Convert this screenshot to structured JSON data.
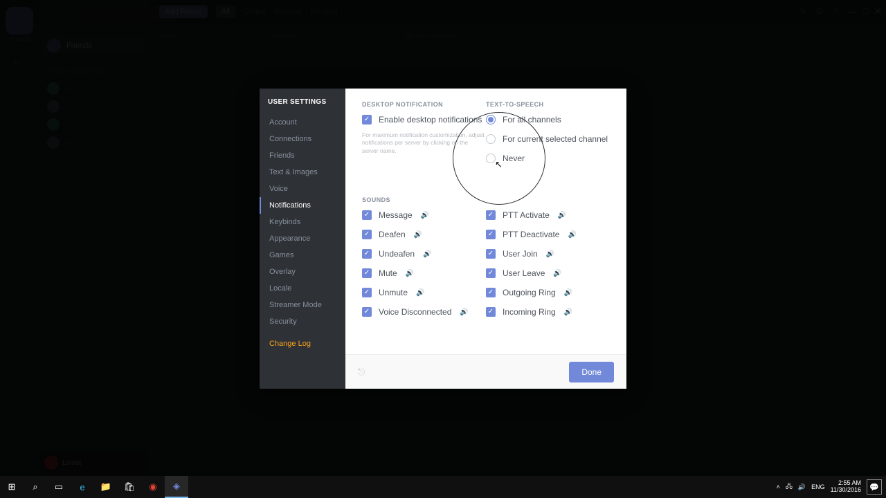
{
  "window": {
    "minimize": "—",
    "maximize": "□",
    "close": "✕"
  },
  "bg": {
    "friends_label": "FRIENDS",
    "add": "+",
    "friends_row": "Friends",
    "dm_header": "DIRECT MESSAGES",
    "tabs": {
      "add": "Add Friend",
      "all": "All",
      "online": "Online",
      "pending": "Pending",
      "blocked": "Blocked"
    },
    "cols": {
      "name": "NAME",
      "status": "STATUS",
      "mutual": "MUTUAL SERVERS"
    },
    "user": {
      "name": "Linnet"
    }
  },
  "modal": {
    "title": "USER SETTINGS",
    "nav": [
      {
        "k": "account",
        "label": "Account"
      },
      {
        "k": "connections",
        "label": "Connections"
      },
      {
        "k": "friends",
        "label": "Friends"
      },
      {
        "k": "text",
        "label": "Text & Images"
      },
      {
        "k": "voice",
        "label": "Voice"
      },
      {
        "k": "notifications",
        "label": "Notifications"
      },
      {
        "k": "keybinds",
        "label": "Keybinds"
      },
      {
        "k": "appearance",
        "label": "Appearance"
      },
      {
        "k": "games",
        "label": "Games"
      },
      {
        "k": "overlay",
        "label": "Overlay"
      },
      {
        "k": "locale",
        "label": "Locale"
      },
      {
        "k": "streamer",
        "label": "Streamer Mode"
      },
      {
        "k": "security",
        "label": "Security"
      },
      {
        "k": "changelog",
        "label": "Change Log"
      }
    ],
    "nav_active": "notifications",
    "sec": {
      "desktop_h": "DESKTOP NOTIFICATION",
      "tts_h": "TEXT-TO-SPEECH",
      "sounds_h": "SOUNDS"
    },
    "desktop": {
      "enable": "Enable desktop notifications",
      "note": "For maximum notification customization, adjust notifications per server by clicking on the server name."
    },
    "tts": [
      {
        "k": "all",
        "label": "For all channels",
        "sel": true
      },
      {
        "k": "current",
        "label": "For current selected channel",
        "sel": false
      },
      {
        "k": "never",
        "label": "Never",
        "sel": false
      }
    ],
    "sounds": {
      "left": [
        {
          "k": "message",
          "label": "Message"
        },
        {
          "k": "deafen",
          "label": "Deafen"
        },
        {
          "k": "undeafen",
          "label": "Undeafen"
        },
        {
          "k": "mute",
          "label": "Mute"
        },
        {
          "k": "unmute",
          "label": "Unmute"
        },
        {
          "k": "vdisc",
          "label": "Voice Disconnected"
        }
      ],
      "right": [
        {
          "k": "ptta",
          "label": "PTT Activate"
        },
        {
          "k": "pttd",
          "label": "PTT Deactivate"
        },
        {
          "k": "ujoin",
          "label": "User Join"
        },
        {
          "k": "uleave",
          "label": "User Leave"
        },
        {
          "k": "oring",
          "label": "Outgoing Ring"
        },
        {
          "k": "iring",
          "label": "Incoming Ring"
        }
      ]
    },
    "done": "Done"
  },
  "taskbar": {
    "lang": "ENG",
    "time": "2:55 AM",
    "date": "11/30/2016"
  }
}
